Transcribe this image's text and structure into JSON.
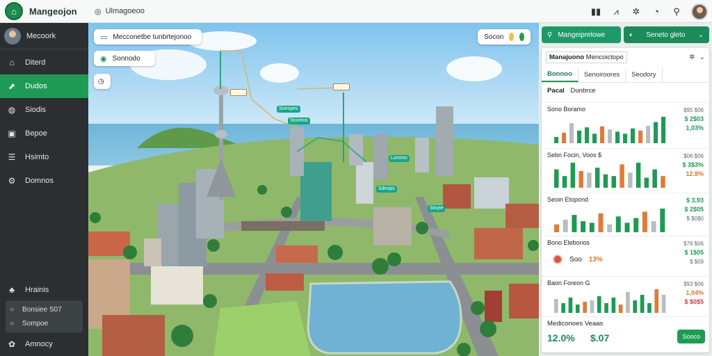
{
  "app": {
    "title": "Mangeojon",
    "location": "Ulmagoeoo"
  },
  "topbar": {
    "icons": [
      "book-icon",
      "chart-icon",
      "bug-icon",
      "bell-icon",
      "search-icon"
    ]
  },
  "sidebar": {
    "user": "Mecoork",
    "items": [
      {
        "label": "Diterd",
        "icon": "home-icon"
      },
      {
        "label": "Dudos",
        "icon": "chart-icon"
      },
      {
        "label": "Siodis",
        "icon": "globe-icon"
      },
      {
        "label": "Bepoe",
        "icon": "lock-icon"
      },
      {
        "label": "Hsimto",
        "icon": "list-icon"
      },
      {
        "label": "Domnos",
        "icon": "gear-icon"
      }
    ],
    "active_index": 1,
    "bottom_heading": "Hrainis",
    "sub_items": [
      "Bonsiee S07",
      "Sompoe"
    ],
    "footer": "Amnocy"
  },
  "map": {
    "search_label": "Mecconetbe tunbrtejonoo",
    "layer_label": "Sonnodo",
    "status_label": "Socon",
    "markers": [
      "Sneopes",
      "Snomns",
      "Loremn",
      "Sdeops",
      "Stoyie"
    ]
  },
  "panel": {
    "tab1": "Mangeiprelowe",
    "tab2": "Seneto gleto",
    "card_title_bold": "Manajuono",
    "card_title_rest": "Mencoictopo",
    "subtabs": [
      "Bonnoo",
      "Senoiroores",
      "Seodory"
    ],
    "active_subtab": 0,
    "section_bold": "Pacal",
    "section_rest": "Dunbrce",
    "metrics": [
      {
        "label": "Sono Boramo",
        "v1": "$95 $06",
        "v2": "$ 2$03",
        "v3": "1,03%"
      },
      {
        "label": "Sebn Focin, Voos $",
        "v1": "$06 $06",
        "v2": "$ 3$3%",
        "v3": "12.8%"
      },
      {
        "label": "Seoin Etopond",
        "v1": "$ 3,93",
        "v2": "$ 2$05",
        "v3": "$ $0$0"
      },
      {
        "label": "Bono Elebonos",
        "v1": "$79 $06",
        "v2": "$ 1$05",
        "v3": "$ $09",
        "pct": "13%",
        "tag": "Soo"
      },
      {
        "label": "Baon Foreon G",
        "v1": "$93 $06",
        "v2": "1,04%",
        "v3": "$ $0$5"
      }
    ],
    "footer_label": "Mediconoes Veaas",
    "footer_v1": "12.0%",
    "footer_v2": "$.07",
    "footer_button": "Sooco"
  },
  "colors": {
    "accent": "#1f9a55",
    "sidebar": "#2b2f31",
    "orange": "#e07b39",
    "grey": "#b8bec0"
  },
  "chart_data": [
    {
      "type": "bar",
      "series": [
        {
          "values": [
            12,
            20,
            38,
            24,
            30,
            18,
            32,
            26,
            22,
            18,
            28,
            24,
            33,
            40,
            50
          ]
        }
      ]
    },
    {
      "type": "bar",
      "series": [
        {
          "values": [
            22,
            14,
            30,
            20,
            18,
            24,
            16,
            14,
            28,
            18,
            30,
            12,
            22,
            14
          ]
        }
      ]
    },
    {
      "type": "bar",
      "series": [
        {
          "values": [
            10,
            16,
            22,
            14,
            12,
            24,
            10,
            20,
            12,
            18,
            26,
            14,
            30
          ]
        }
      ]
    },
    {
      "type": "bar",
      "series": [
        {
          "values": []
        }
      ]
    },
    {
      "type": "bar",
      "series": [
        {
          "values": [
            20,
            14,
            22,
            12,
            16,
            18,
            24,
            14,
            22,
            12,
            30,
            18,
            26,
            14,
            34,
            26
          ]
        }
      ]
    }
  ]
}
